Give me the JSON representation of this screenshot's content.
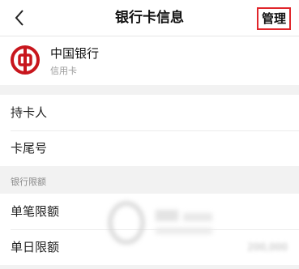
{
  "nav": {
    "title": "银行卡信息",
    "manage_label": "管理",
    "back_glyph": "‹"
  },
  "bank": {
    "name": "中国银行",
    "card_type": "信用卡",
    "logo_color": "#c8161d"
  },
  "card_info": {
    "holder_label": "持卡人",
    "holder_value": "",
    "tail_label": "卡尾号",
    "tail_value": ""
  },
  "limits": {
    "section_title": "银行限额",
    "single_label": "单笔限额",
    "single_value": "",
    "daily_label": "单日限额",
    "daily_value": "200,000"
  },
  "colors": {
    "accent_border": "#e0262b"
  }
}
